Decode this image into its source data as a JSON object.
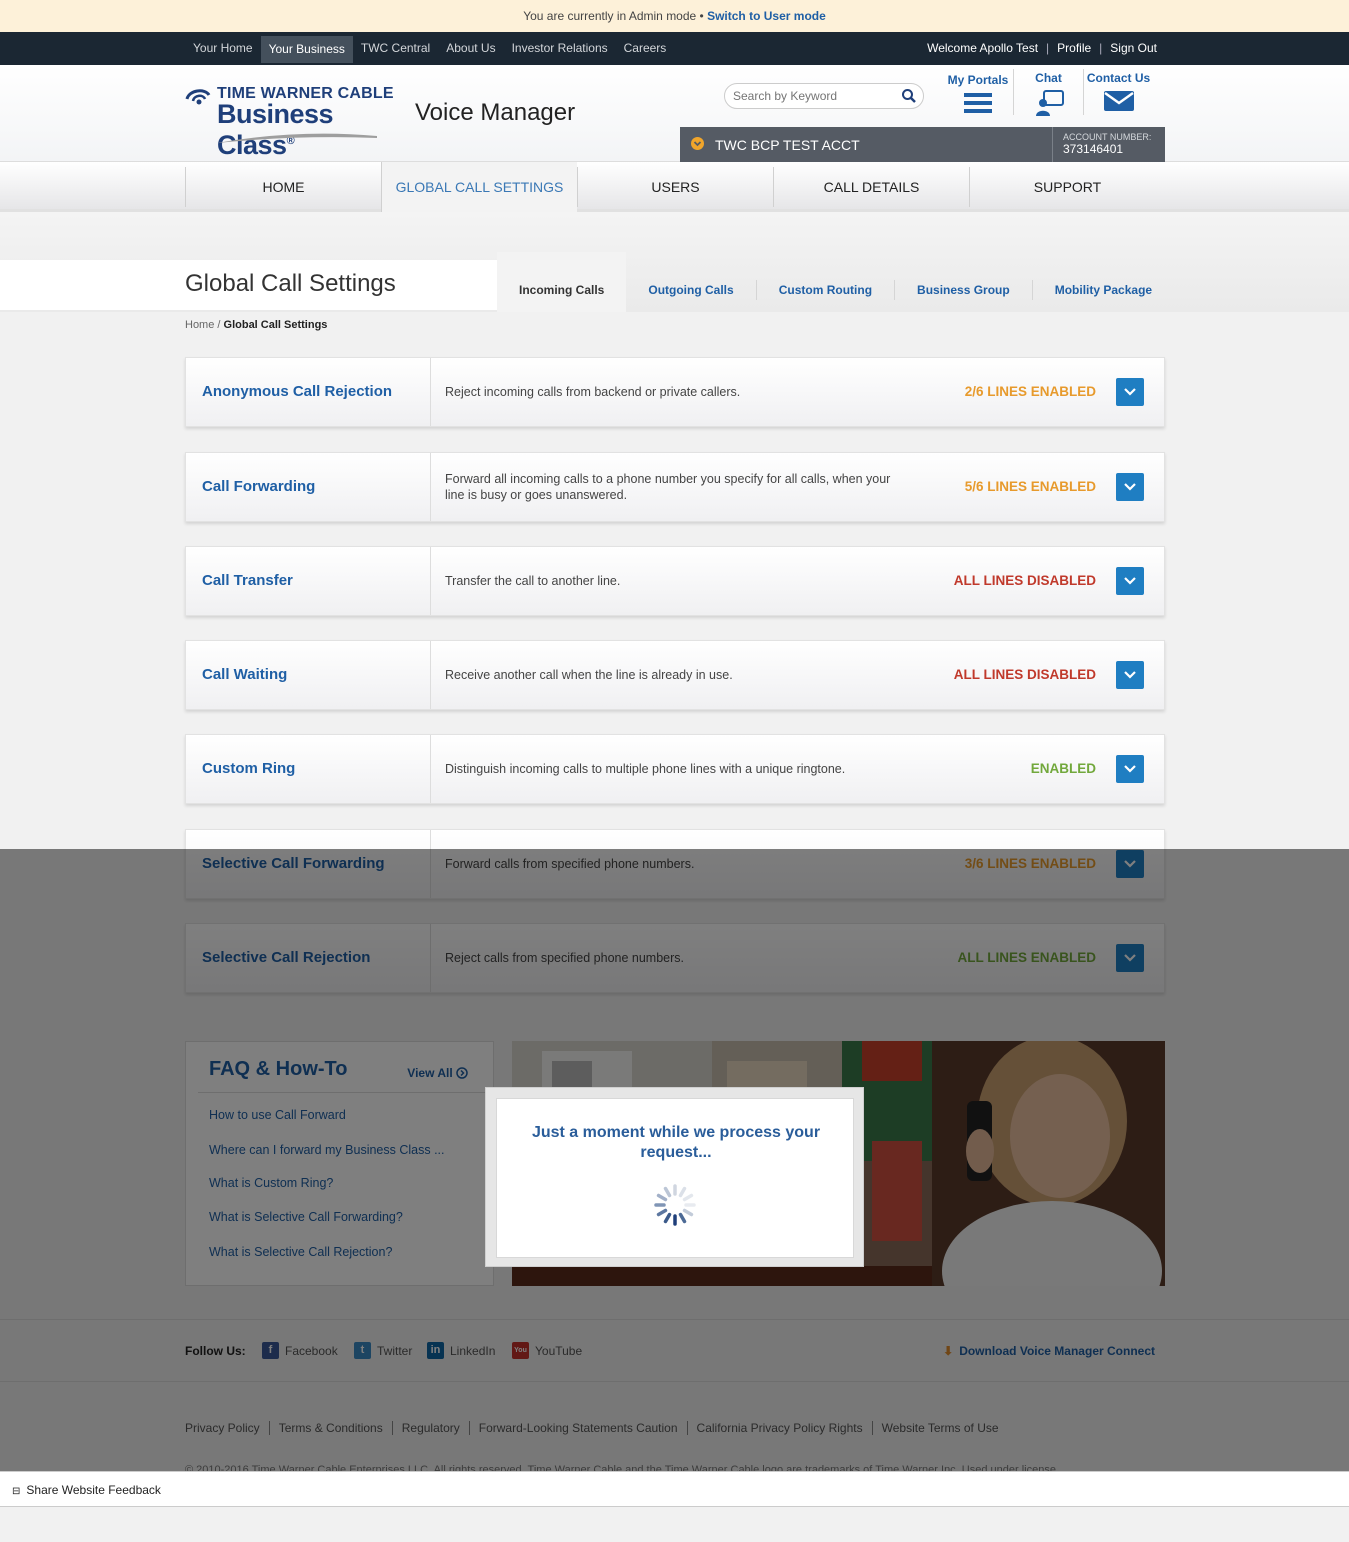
{
  "admin_bar": {
    "text": "You are currently in Admin mode •",
    "link": "Switch to User mode"
  },
  "topnav": {
    "left": [
      "Your Home",
      "Your Business",
      "TWC Central",
      "About Us",
      "Investor Relations",
      "Careers"
    ],
    "active_index": 1,
    "welcome": "Welcome Apollo Test",
    "profile": "Profile",
    "sign_out": "Sign Out"
  },
  "header": {
    "logo_line1": "TIME WARNER CABLE",
    "logo_line2": "Business Class",
    "logo_reg": "®",
    "product": "Voice Manager",
    "search_placeholder": "Search by Keyword",
    "links": {
      "portals": "My Portals",
      "chat": "Chat",
      "contact": "Contact Us"
    },
    "account_name": "TWC BCP TEST ACCT",
    "account_label": "ACCOUNT NUMBER:",
    "account_number": "373146401"
  },
  "mainnav": [
    "HOME",
    "GLOBAL CALL SETTINGS",
    "USERS",
    "CALL DETAILS",
    "SUPPORT"
  ],
  "page_title": "Global Call Settings",
  "subtabs": [
    "Incoming Calls",
    "Outgoing Calls",
    "Custom Routing",
    "Business Group",
    "Mobility Package"
  ],
  "breadcrumb": {
    "home": "Home",
    "sep": " / ",
    "current": "Global Call Settings"
  },
  "features": [
    {
      "name": "Anonymous Call Rejection",
      "desc": "Reject incoming calls from backend or private callers.",
      "status": "2/6 LINES ENABLED",
      "status_color": "#e79a2c"
    },
    {
      "name": "Call Forwarding",
      "desc": "Forward all incoming calls to a phone number you specify for all calls, when your line is busy or goes unanswered.",
      "status": "5/6 LINES ENABLED",
      "status_color": "#e79a2c"
    },
    {
      "name": "Call Transfer",
      "desc": "Transfer the call to another line.",
      "status": "ALL LINES DISABLED",
      "status_color": "#c0392b"
    },
    {
      "name": "Call Waiting",
      "desc": "Receive another call when the line is already in use.",
      "status": "ALL LINES DISABLED",
      "status_color": "#c0392b"
    },
    {
      "name": "Custom Ring",
      "desc": "Distinguish incoming calls to multiple phone lines with a unique ringtone.",
      "status": "ENABLED",
      "status_color": "#72a83c"
    },
    {
      "name": "Selective Call Forwarding",
      "desc": "Forward calls from specified phone numbers.",
      "status": "3/6 LINES ENABLED",
      "status_color": "#e79a2c"
    },
    {
      "name": "Selective Call Rejection",
      "desc": "Reject calls from specified phone numbers.",
      "status": "ALL LINES ENABLED",
      "status_color": "#72a83c"
    }
  ],
  "faq": {
    "title": "FAQ & How-To",
    "view_all": "View All",
    "questions": [
      "How to use Call Forward",
      "Where can I forward my Business Class ...",
      "What is Custom Ring?",
      "What is Selective Call Forwarding?",
      "What is Selective Call Rejection?"
    ]
  },
  "follow": {
    "label": "Follow Us:",
    "facebook": "Facebook",
    "twitter": "Twitter",
    "linkedin": "LinkedIn",
    "youtube": "YouTube",
    "download": "Download Voice Manager Connect"
  },
  "footer_links": [
    "Privacy Policy",
    "Terms & Conditions",
    "Regulatory",
    "Forward-Looking Statements Caution",
    "California Privacy Policy Rights",
    "Website Terms of Use"
  ],
  "copyright": "© 2010-2016 Time Warner Cable Enterprises LLC. All rights reserved. Time Warner Cable and the Time Warner Cable logo are trademarks of Time Warner Inc. Used under license.",
  "feedback": "Share Website Feedback",
  "modal": {
    "message": "Just a moment while we process your request..."
  }
}
